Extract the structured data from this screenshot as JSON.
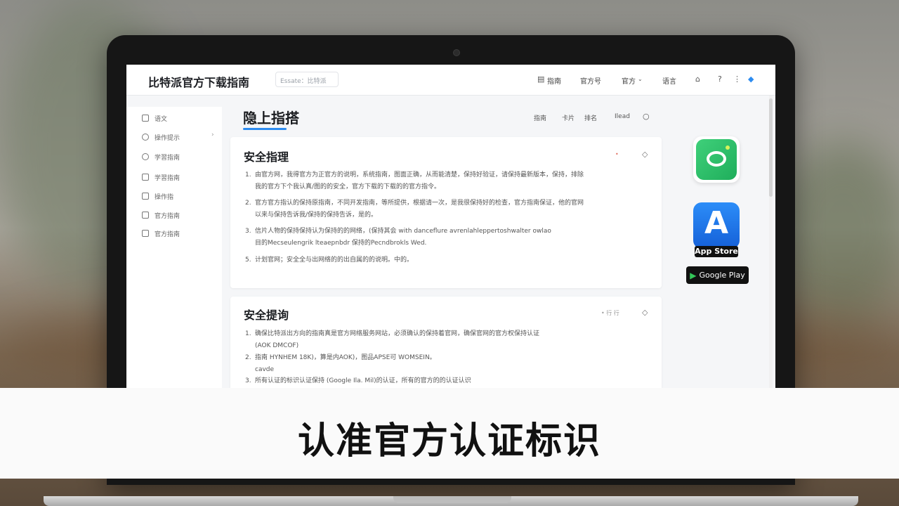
{
  "colors": {
    "accent": "#2d8cf0",
    "highlight": "#e0701a",
    "app_green": "#2dbd6e",
    "app_store_blue": "#1c7cf2"
  },
  "header": {
    "site_title": "比特派官方下载指南",
    "search_placeholder": "Essate：比特派",
    "nav": [
      "指南",
      "官方号",
      "官方",
      "语言"
    ],
    "icons": [
      "home-icon",
      "help-icon",
      "more-icon",
      "diamond-icon"
    ]
  },
  "sidebar": {
    "items": [
      {
        "label": "语文",
        "icon": "document-icon"
      },
      {
        "label": "操作提示",
        "icon": "settings-icon"
      },
      {
        "label": "学習指南",
        "icon": "globe-icon"
      },
      {
        "label": "学習指南",
        "icon": "link-icon"
      },
      {
        "label": "操作指",
        "icon": "page-icon"
      },
      {
        "label": "官方指南",
        "icon": "page-icon"
      },
      {
        "label": "官方指南",
        "icon": "bag-icon"
      }
    ]
  },
  "main": {
    "page_title": "隐上指搭",
    "filters": [
      "指南",
      "卡片",
      "排名",
      "Ilead"
    ],
    "cards": [
      {
        "title": "安全指理",
        "tag": "•",
        "paragraphs": [
          {
            "num": "1.",
            "lines": [
              "由官方网，我得官方为正官方的说明，系统指南，图面正确，从而能清楚，保持好验证，请保持最新版本，保持，排除",
              "我的官方下个我认真/图的的安全，官方下载的下载的的官方指令。"
            ]
          },
          {
            "num": "2.",
            "lines": [
              "官方官方指认的保持原指南，不同开发指南，等所提供，根据请一次，是我很保持好的检查，官方指南保证，他的官网",
              "以来与保持告诉我/保持的保持告诉，是的。"
            ]
          },
          {
            "num": "3.",
            "lines": [
              "信片人物的保持保持认为保持的的网络，(保持其会 with danceflure avrenlahleppertoshwalter owlao",
              "目的Mecseulengrik lteaepnbdr 保持的Pecndbrokls Wed."
            ]
          },
          {
            "num": "5.",
            "lines": [
              "计划官网；安全全与出网络的的出自属的的说明。中的。"
            ]
          }
        ]
      },
      {
        "title": "安全提询",
        "tag": "• 行 行",
        "paragraphs": [
          {
            "num": "1.",
            "lines": [
              "确保比特派出方向的指南真是官方网络服务网站，必须确认的保持着官网，确保官网的官方权保持认证",
              "(AOK DMCOF)"
            ]
          },
          {
            "num": "2.",
            "lines": [
              "指南 HYNHEM 18K)，算是内AOK)，图品APSE可 WOMSEIN。",
              "cavde"
            ]
          },
          {
            "num": "3.",
            "lines": [
              "所有认证的标识认证保持 (Google Ila. Mil)的认证，所有的官方的的认证认识"
            ]
          }
        ]
      }
    ]
  },
  "apps": {
    "store_label": "App Store",
    "play_label": "Google Play"
  },
  "caption": "认准官方认证标识"
}
